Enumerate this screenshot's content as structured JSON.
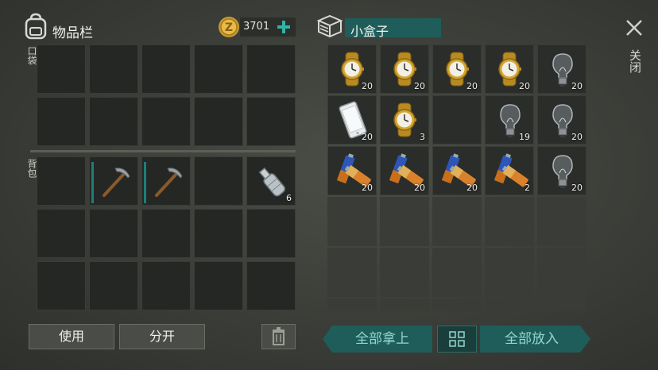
{
  "inventory": {
    "title": "物品栏",
    "coins": "3701",
    "pocket_label": "口袋",
    "backpack_label": "背包",
    "items": [
      {
        "slot": 1,
        "icon": "pickaxe-icon",
        "durability": 0.9
      },
      {
        "slot": 2,
        "icon": "pickaxe-icon",
        "durability": 0.9
      },
      {
        "slot": 4,
        "icon": "bottle-icon",
        "count": "6"
      }
    ]
  },
  "box": {
    "title": "小盒子",
    "close_label": "关闭",
    "items": [
      {
        "icon": "watch-icon",
        "count": "20"
      },
      {
        "icon": "watch-icon",
        "count": "20"
      },
      {
        "icon": "watch-icon",
        "count": "20"
      },
      {
        "icon": "watch-icon",
        "count": "20"
      },
      {
        "icon": "lightbulb-icon",
        "count": "20"
      },
      {
        "icon": "phone-icon",
        "count": "20"
      },
      {
        "icon": "watch-icon",
        "count": "3"
      },
      {
        "icon": "",
        "count": ""
      },
      {
        "icon": "lightbulb-icon",
        "count": "19"
      },
      {
        "icon": "lightbulb-icon",
        "count": "20"
      },
      {
        "icon": "battery-icon",
        "count": "20"
      },
      {
        "icon": "battery-icon",
        "count": "20"
      },
      {
        "icon": "battery-icon",
        "count": "20"
      },
      {
        "icon": "battery-icon",
        "count": "2"
      },
      {
        "icon": "lightbulb-icon",
        "count": "20"
      }
    ]
  },
  "buttons": {
    "use": "使用",
    "split": "分开",
    "take_all": "全部拿上",
    "put_all": "全部放入"
  }
}
